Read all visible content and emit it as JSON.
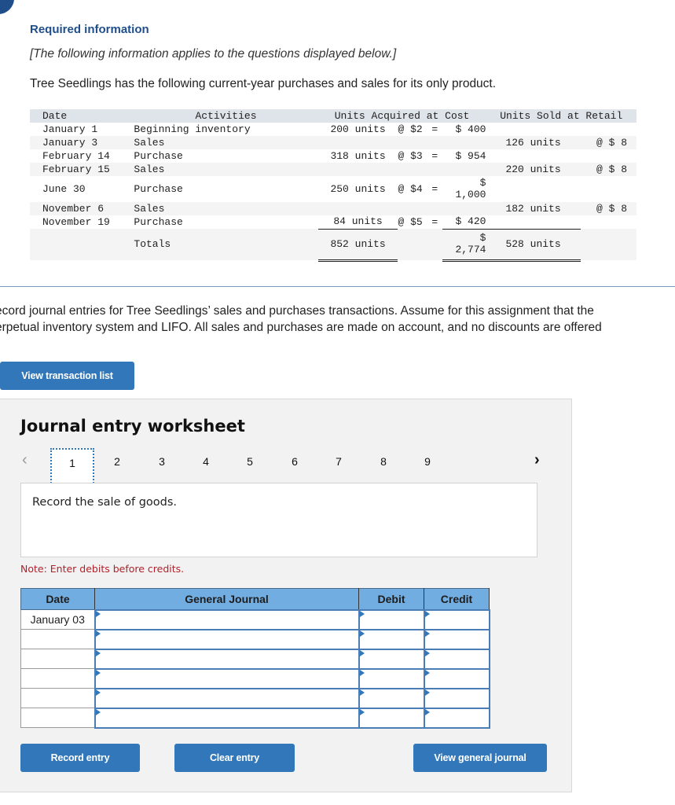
{
  "header": {
    "title": "Required information",
    "subtitle": "[The following information applies to the questions displayed below.]",
    "intro": "Tree Seedlings has the following current-year purchases and sales for its only product."
  },
  "inventory_table": {
    "headers": {
      "date": "Date",
      "activities": "Activities",
      "acquired": "Units Acquired at Cost",
      "sold": "Units Sold at Retail"
    },
    "rows": [
      {
        "date": "January 1",
        "activity": "Beginning inventory",
        "units": "200 units",
        "at": "@ $2",
        "eq": "=",
        "cost": "$ 400",
        "sold": "",
        "retail": ""
      },
      {
        "date": "January 3",
        "activity": "Sales",
        "units": "",
        "at": "",
        "eq": "",
        "cost": "",
        "sold": "126 units",
        "retail": "@ $ 8"
      },
      {
        "date": "February 14",
        "activity": "Purchase",
        "units": "318 units",
        "at": "@ $3",
        "eq": "=",
        "cost": "$ 954",
        "sold": "",
        "retail": ""
      },
      {
        "date": "February 15",
        "activity": "Sales",
        "units": "",
        "at": "",
        "eq": "",
        "cost": "",
        "sold": "220 units",
        "retail": "@ $ 8"
      },
      {
        "date": "June 30",
        "activity": "Purchase",
        "units": "250 units",
        "at": "@ $4",
        "eq": "=",
        "cost_sym": "$",
        "cost": "1,000",
        "sold": "",
        "retail": ""
      },
      {
        "date": "November 6",
        "activity": "Sales",
        "units": "",
        "at": "",
        "eq": "",
        "cost": "",
        "sold": "182 units",
        "retail": "@ $ 8"
      },
      {
        "date": "November 19",
        "activity": "Purchase",
        "units": "84 units",
        "at": "@ $5",
        "eq": "=",
        "cost": "$ 420",
        "sold": "",
        "retail": ""
      }
    ],
    "totals": {
      "label": "Totals",
      "units": "852 units",
      "cost_sym": "$",
      "cost": "2,774",
      "sold": "528 units"
    }
  },
  "instructions": {
    "line1": "ecord journal entries for Tree Seedlings’ sales and purchases transactions. Assume for this assignment that the",
    "line2": "erpetual inventory system and LIFO. All sales and purchases are made on account, and no discounts are offered"
  },
  "buttons": {
    "view_transaction_list": "View transaction list",
    "record_entry": "Record entry",
    "clear_entry": "Clear entry",
    "view_general_journal": "View general journal"
  },
  "worksheet": {
    "title": "Journal entry worksheet",
    "pages": [
      "1",
      "2",
      "3",
      "4",
      "5",
      "6",
      "7",
      "8",
      "9"
    ],
    "active_page": "1",
    "prev_icon": "‹",
    "next_icon": "›",
    "description": "Record the sale of goods.",
    "note": "Note: Enter debits before credits."
  },
  "journal": {
    "headers": {
      "date": "Date",
      "general_journal": "General Journal",
      "debit": "Debit",
      "credit": "Credit"
    },
    "rows": [
      {
        "date": "January 03",
        "account": "",
        "debit": "",
        "credit": ""
      },
      {
        "date": "",
        "account": "",
        "debit": "",
        "credit": ""
      },
      {
        "date": "",
        "account": "",
        "debit": "",
        "credit": ""
      },
      {
        "date": "",
        "account": "",
        "debit": "",
        "credit": ""
      },
      {
        "date": "",
        "account": "",
        "debit": "",
        "credit": ""
      },
      {
        "date": "",
        "account": "",
        "debit": "",
        "credit": ""
      }
    ]
  },
  "colors": {
    "primary_button": "#3277b9",
    "title_blue": "#1f4e8a",
    "table_header": "#72ade1",
    "note_red": "#b0212a"
  }
}
